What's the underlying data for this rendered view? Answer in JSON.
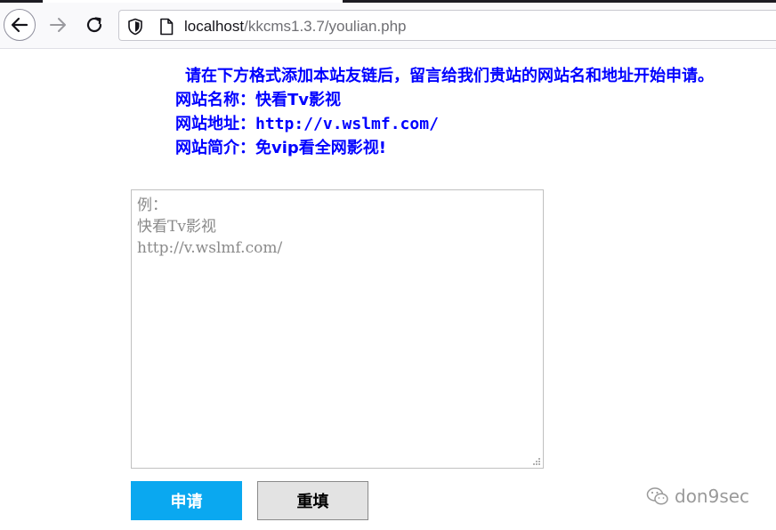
{
  "browser": {
    "url_host": "localhost",
    "url_path": "/kkcms1.3.7/youlian.php"
  },
  "notice": {
    "intro": "请在下方格式添加本站友链后，留言给我们贵站的网站名和地址开始申请。",
    "site_name_label": "网站名称：",
    "site_name_value": "快看Tv影视",
    "site_url_label": "网站地址：",
    "site_url_value": "http://v.wslmf.com/",
    "site_desc_label": "网站简介：",
    "site_desc_value": "免vip看全网影视!"
  },
  "form": {
    "textarea_placeholder": "例：\n快看Tv影视\nhttp://v.wslmf.com/",
    "submit_label": "申请",
    "reset_label": "重填"
  },
  "watermark": {
    "text": "don9sec",
    "icon": "wechat-icon"
  },
  "colors": {
    "notice_text": "#0000ff",
    "submit_bg": "#0aa8f0",
    "reset_bg": "#e3e3e3"
  }
}
